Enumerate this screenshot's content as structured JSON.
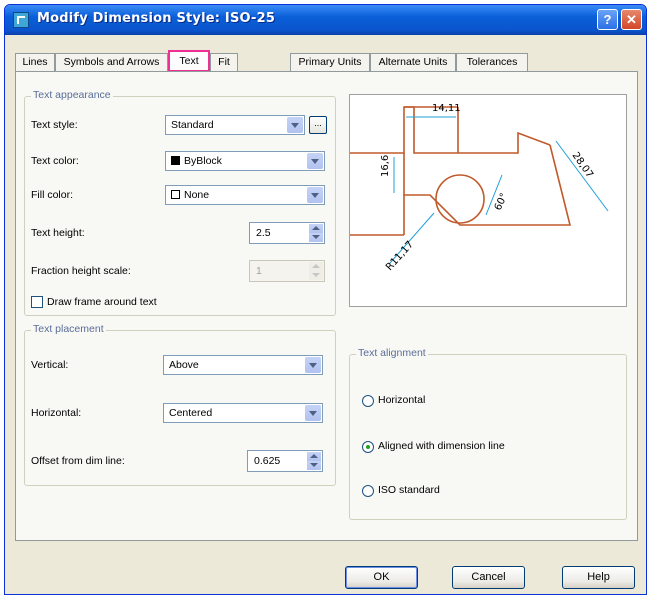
{
  "window": {
    "title": "Modify Dimension Style: ISO-25",
    "help_glyph": "?",
    "close_glyph": "✕"
  },
  "tabs": [
    {
      "label": "Lines",
      "active": false
    },
    {
      "label": "Symbols and Arrows",
      "active": false
    },
    {
      "label": "Text",
      "active": true
    },
    {
      "label": "Fit",
      "active": false
    },
    {
      "label": "Primary Units",
      "active": false
    },
    {
      "label": "Alternate Units",
      "active": false
    },
    {
      "label": "Tolerances",
      "active": false
    }
  ],
  "text_appearance": {
    "legend": "Text appearance",
    "text_style": {
      "label": "Text style:",
      "value": "Standard",
      "browse_label": "..."
    },
    "text_color": {
      "label": "Text color:",
      "value": "ByBlock",
      "swatch": "#000000"
    },
    "fill_color": {
      "label": "Fill color:",
      "value": "None",
      "swatch": "#ffffff"
    },
    "text_height": {
      "label": "Text height:",
      "value": "2.5"
    },
    "fraction_height_scale": {
      "label": "Fraction height scale:",
      "value": "1",
      "enabled": false
    },
    "draw_frame": {
      "label": "Draw frame around text",
      "checked": false
    }
  },
  "text_placement": {
    "legend": "Text placement",
    "vertical": {
      "label": "Vertical:",
      "value": "Above"
    },
    "horizontal": {
      "label": "Horizontal:",
      "value": "Centered"
    },
    "offset": {
      "label": "Offset from dim line:",
      "value": "0.625"
    }
  },
  "preview": {
    "dim_top": "14,11",
    "dim_left": "16,6",
    "dim_right": "28,07",
    "dim_angle": "60°",
    "dim_radius": "R11,17",
    "line_color": "#c05a2a",
    "dim_color": "#1e9fd8"
  },
  "text_alignment": {
    "legend": "Text alignment",
    "options": [
      {
        "label": "Horizontal",
        "selected": false
      },
      {
        "label": "Aligned with dimension line",
        "selected": true
      },
      {
        "label": "ISO standard",
        "selected": false
      }
    ]
  },
  "buttons": {
    "ok": "OK",
    "cancel": "Cancel",
    "help": "Help"
  }
}
